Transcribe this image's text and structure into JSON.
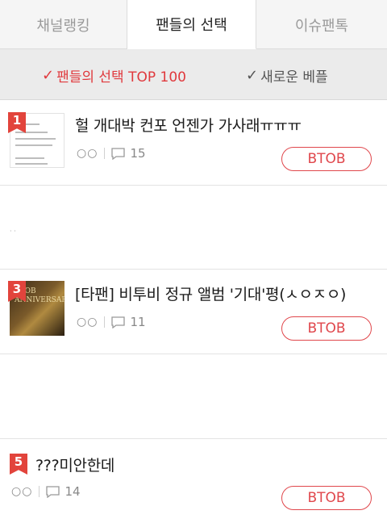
{
  "tabs": [
    {
      "label": "채널랭킹"
    },
    {
      "label": "팬들의 선택"
    },
    {
      "label": "이슈팬톡"
    }
  ],
  "subtabs": [
    {
      "label": "팬들의 선택 TOP 100",
      "icon": "checkmark-icon",
      "color": "#e0393d"
    },
    {
      "label": "새로운 베플",
      "icon": "checkmark-icon",
      "color": "#555555"
    }
  ],
  "items": [
    {
      "rank": "1",
      "title": "헐 개대박 컨포 언젠가 가사래ㅠㅠㅠ",
      "reactions": "○○",
      "comments": "15",
      "tag": "BTOB"
    },
    {
      "rank": "3",
      "title": "[타팬] 비투비 정규 앨범 '기대'평(ㅅㅇㅈㅇ)",
      "reactions": "○○",
      "comments": "11",
      "tag": "BTOB"
    },
    {
      "rank": "5",
      "title": "???미안한데",
      "reactions": "○○",
      "comments": "14",
      "tag": "BTOB"
    }
  ],
  "thumb3_text": "BTOB\nANNIVERSARY",
  "colors": {
    "accent": "#e0474c",
    "badge": "#e2443c"
  }
}
